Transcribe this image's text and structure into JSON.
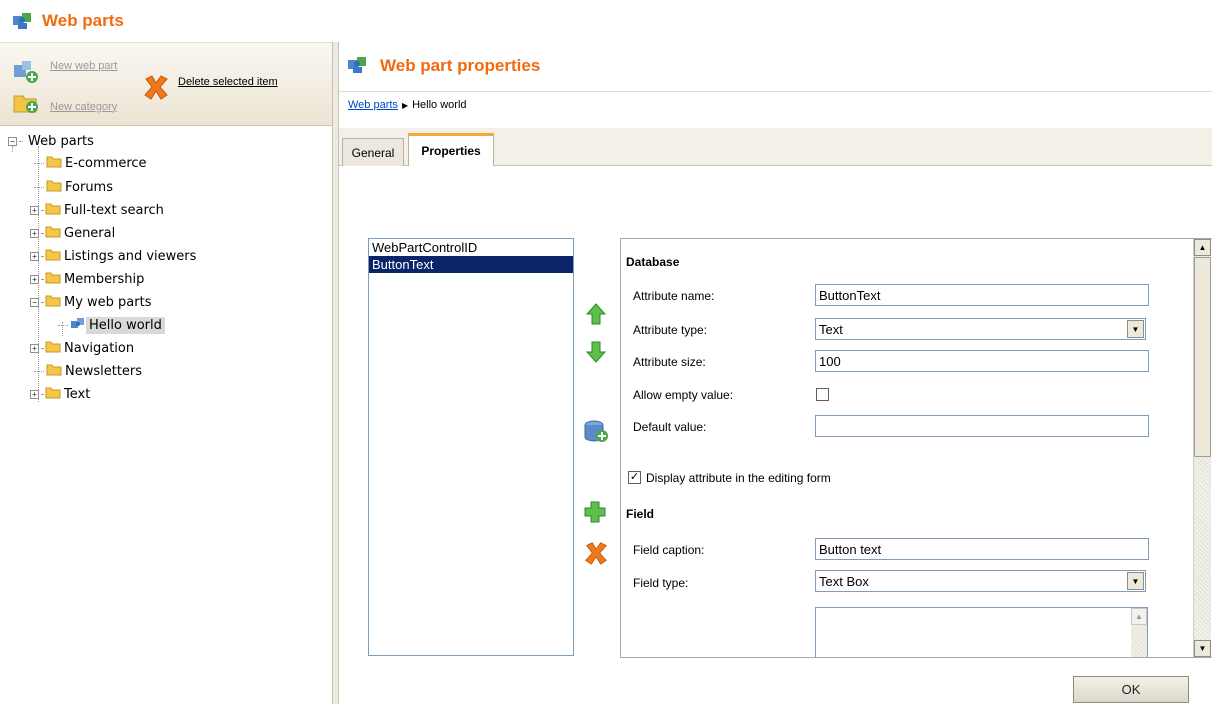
{
  "app": {
    "title": "Web parts",
    "icon": "webparts-puzzle-icon",
    "accent": "#f26a10"
  },
  "toolbar": {
    "new_web_part": "New web part",
    "new_category": "New category",
    "delete_selected": "Delete selected item"
  },
  "tree": {
    "root": "Web parts",
    "items": [
      {
        "label": "E-commerce"
      },
      {
        "label": "Forums"
      },
      {
        "label": "Full-text search"
      },
      {
        "label": "General"
      },
      {
        "label": "Listings and viewers"
      },
      {
        "label": "Membership"
      },
      {
        "label": "My web parts"
      },
      {
        "label": "Hello world"
      },
      {
        "label": "Navigation"
      },
      {
        "label": "Newsletters"
      },
      {
        "label": "Text"
      }
    ]
  },
  "panel": {
    "title": "Web part properties",
    "breadcrumb": {
      "link": "Web parts",
      "current": "Hello world"
    },
    "tabs": [
      {
        "label": "General"
      },
      {
        "label": "Properties"
      }
    ],
    "active_tab": "Properties"
  },
  "attributes": {
    "items": [
      "WebPartControlID",
      "ButtonText"
    ],
    "selected": "ButtonText"
  },
  "form": {
    "database_heading": "Database",
    "attribute_name_label": "Attribute name:",
    "attribute_name_value": "ButtonText",
    "attribute_type_label": "Attribute type:",
    "attribute_type_value": "Text",
    "attribute_size_label": "Attribute size:",
    "attribute_size_value": "100",
    "allow_empty_label": "Allow empty value:",
    "allow_empty_checked": false,
    "default_value_label": "Default value:",
    "default_value_value": "",
    "display_in_form_label": "Display attribute in the editing form",
    "display_in_form_checked": true,
    "field_heading": "Field",
    "field_caption_label": "Field caption:",
    "field_caption_value": "Button text",
    "field_type_label": "Field type:",
    "field_type_value": "Text Box"
  },
  "buttons": {
    "ok": "OK"
  }
}
